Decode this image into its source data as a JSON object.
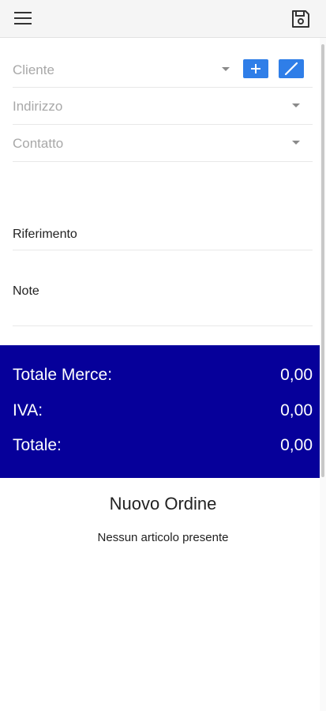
{
  "header": {
    "menu_icon": "hamburger-menu-icon",
    "save_icon": "floppy-disk-save-icon"
  },
  "form": {
    "cliente": {
      "placeholder": "Cliente",
      "add_label": "+",
      "edit_icon": "pencil-icon"
    },
    "indirizzo": {
      "placeholder": "Indirizzo"
    },
    "contatto": {
      "placeholder": "Contatto"
    },
    "riferimento": {
      "label": "Riferimento"
    },
    "note": {
      "label": "Note"
    }
  },
  "totals": {
    "rows": [
      {
        "label": "Totale Merce:",
        "value": "0,00"
      },
      {
        "label": "IVA:",
        "value": "0,00"
      },
      {
        "label": "Totale:",
        "value": "0,00"
      }
    ]
  },
  "order": {
    "title": "Nuovo Ordine",
    "empty_message": "Nessun articolo presente"
  },
  "colors": {
    "totals_background": "#06009a",
    "action_button": "#2f7ee8"
  }
}
